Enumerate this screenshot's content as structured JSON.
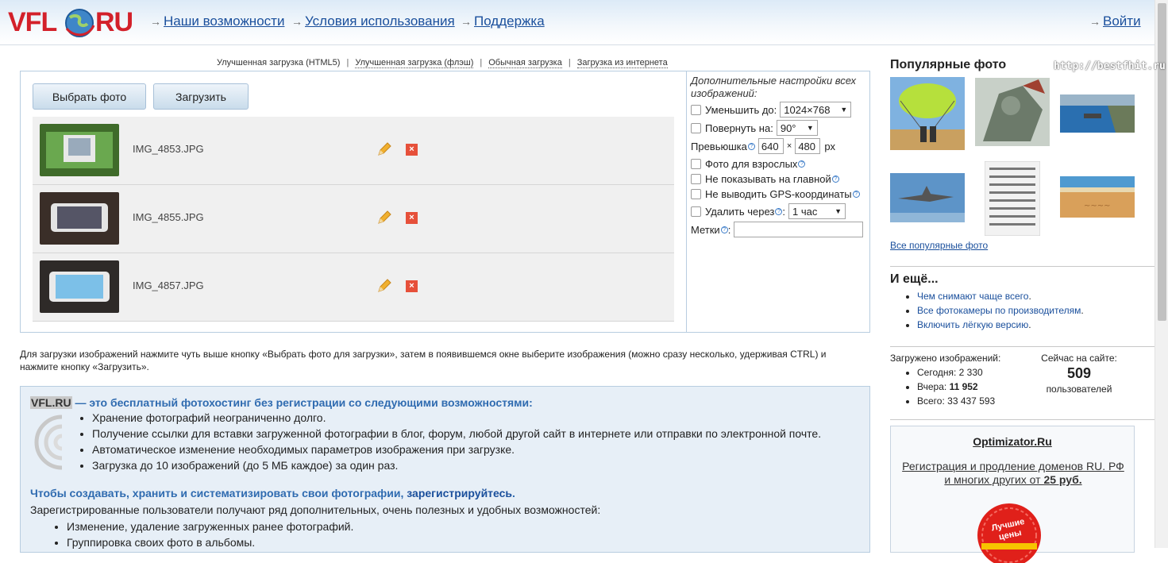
{
  "header": {
    "logo_left": "VFL",
    "logo_right": "RU",
    "nav": [
      "Наши возможности",
      "Условия использования",
      "Поддержка"
    ],
    "login": "Войти"
  },
  "upload_tabs": [
    "Улучшенная загрузка (HTML5)",
    "Улучшенная загрузка (флэш)",
    "Обычная загрузка",
    "Загрузка из интернета"
  ],
  "buttons": {
    "choose": "Выбрать фото",
    "upload": "Загрузить"
  },
  "files": [
    {
      "name": "IMG_4853.JPG"
    },
    {
      "name": "IMG_4855.JPG"
    },
    {
      "name": "IMG_4857.JPG"
    }
  ],
  "settings": {
    "title": "Дополнительные настройки всех изображений:",
    "resize_label": "Уменьшить до:",
    "resize_value": "1024×768",
    "rotate_label": "Повернуть на:",
    "rotate_value": "90°",
    "thumb_label": "Превьюшка",
    "thumb_w": "640",
    "thumb_x": "×",
    "thumb_h": "480",
    "thumb_unit": "px",
    "adult_label": "Фото для взрослых",
    "nomain_label": "Не показывать на главной",
    "nogps_label": "Не выводить GPS-координаты",
    "delete_label": "Удалить через",
    "delete_value": "1 час",
    "tags_label": "Метки",
    "tags_value": ""
  },
  "instructions": "Для загрузки изображений нажмите чуть выше кнопку «Выбрать фото для загрузки», затем в появившемся окне выберите изображения (можно сразу несколько, удерживая CTRL) и нажмите кнопку «Загрузить».",
  "info": {
    "brand": "VFL.RU",
    "headline": " — это бесплатный фотохостинг без регистрации со следующими возможностями:",
    "features": [
      "Хранение фотографий неограниченно долго.",
      "Получение ссылки для вставки загруженной фотографии в блог, форум, любой другой сайт в интернете или отправки по электронной почте.",
      "Автоматическое изменение необходимых параметров изображения при загрузке.",
      "Загрузка до 10 изображений (до 5 МБ каждое) за один раз."
    ],
    "reg_head": "Чтобы создавать, хранить и систематизировать свои фотографии, ",
    "reg_link": "зарегистрируйтесь",
    "reg_dot": ".",
    "reg_text": "Зарегистрированные пользователи получают ряд дополнительных, очень полезных и удобных возможностей:",
    "reg_features": [
      "Изменение, удаление загруженных ранее фотографий.",
      "Группировка своих фото в альбомы."
    ]
  },
  "sidebar": {
    "popular_title": "Популярные фото",
    "watermark": "http://bestfhit.ru",
    "popular_link": "Все популярные фото",
    "more_title": "И ещё...",
    "more_links": [
      "Чем снимают чаще всего",
      "Все фотокамеры по производителям",
      "Включить лёгкую версию"
    ],
    "stats_title": "Загружено изображений:",
    "stats": [
      {
        "label": "Сегодня:",
        "value": "2 330"
      },
      {
        "label": "Вчера:",
        "value": "11 952"
      },
      {
        "label": "Всего:",
        "value": "33 437 593"
      }
    ],
    "online_title": "Сейчас на сайте:",
    "online_count": "509",
    "online_unit": "пользователей",
    "ad_title": "Optimizator.Ru",
    "ad_text_1": "Регистрация и продление доменов RU. РФ и многих других от ",
    "ad_price": "25 руб.",
    "ad_badge": "Лучшие цены"
  }
}
